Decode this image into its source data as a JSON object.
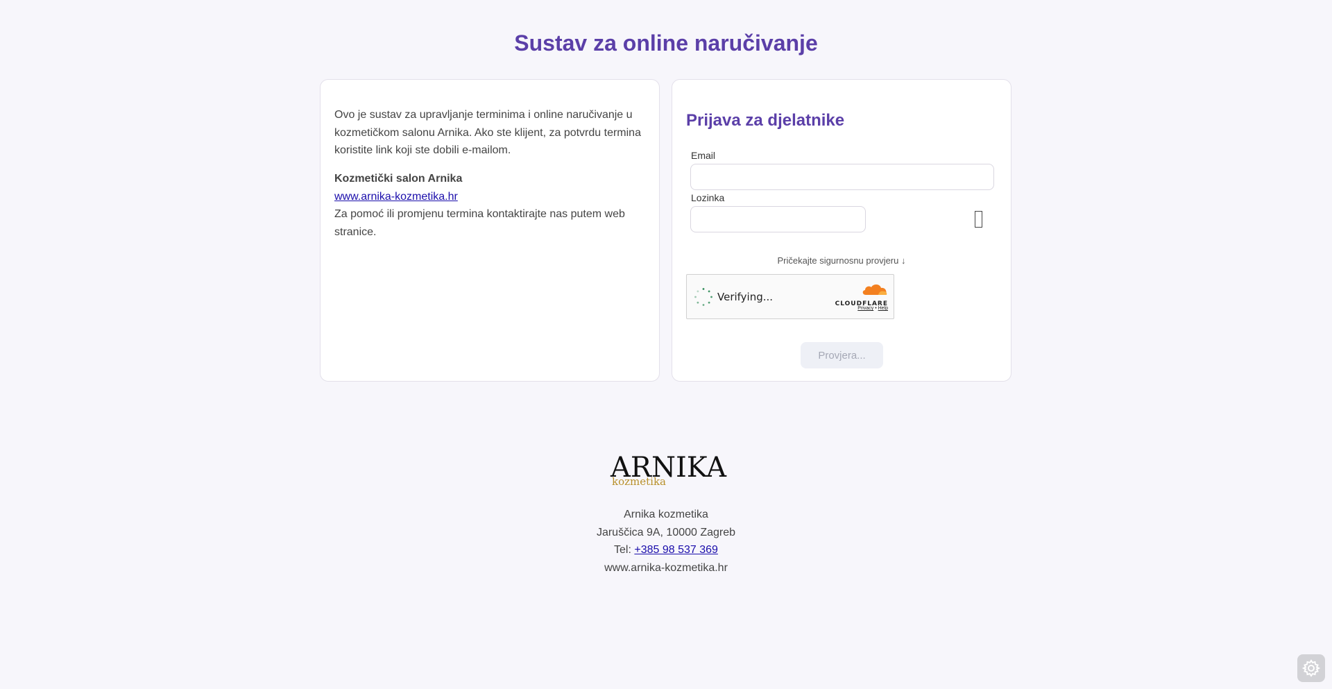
{
  "title": "Sustav za online naručivanje",
  "intro": {
    "text": "Ovo je sustav za upravljanje terminima i online naručivanje u kozmetičkom salonu Arnika. Ako ste klijent, za potvrdu termina koristite link koji ste dobili e-mailom.",
    "salon_name": "Kozmetički salon Arnika",
    "website_link": "www.arnika-kozmetika.hr",
    "help_text": "Za pomoć ili promjenu termina kontaktirajte nas putem web stranice."
  },
  "login": {
    "title": "Prijava za djelatnike",
    "email_label": "Email",
    "email_value": "",
    "password_label": "Lozinka",
    "password_value": "",
    "security_wait_text": "Pričekajte sigurnosnu provjeru ↓",
    "captcha": {
      "status_text": "Verifying...",
      "brand": "CLOUDFLARE",
      "privacy_link": "Privacy",
      "separator": "•",
      "help_link": "Help"
    },
    "submit_label": "Provjera..."
  },
  "footer": {
    "logo_text": "ARNIKA",
    "logo_subtext": "kozmetika",
    "company": "Arnika kozmetika",
    "address": "Jaruščica 9A, 10000 Zagreb",
    "tel_label": "Tel:",
    "tel_number": "+385 98 537 369",
    "website": "www.arnika-kozmetika.hr"
  },
  "colors": {
    "accent": "#5b3fa8",
    "link": "#1a0dab",
    "logo_gold": "#b8902a",
    "cloudflare_orange": "#f38020"
  }
}
